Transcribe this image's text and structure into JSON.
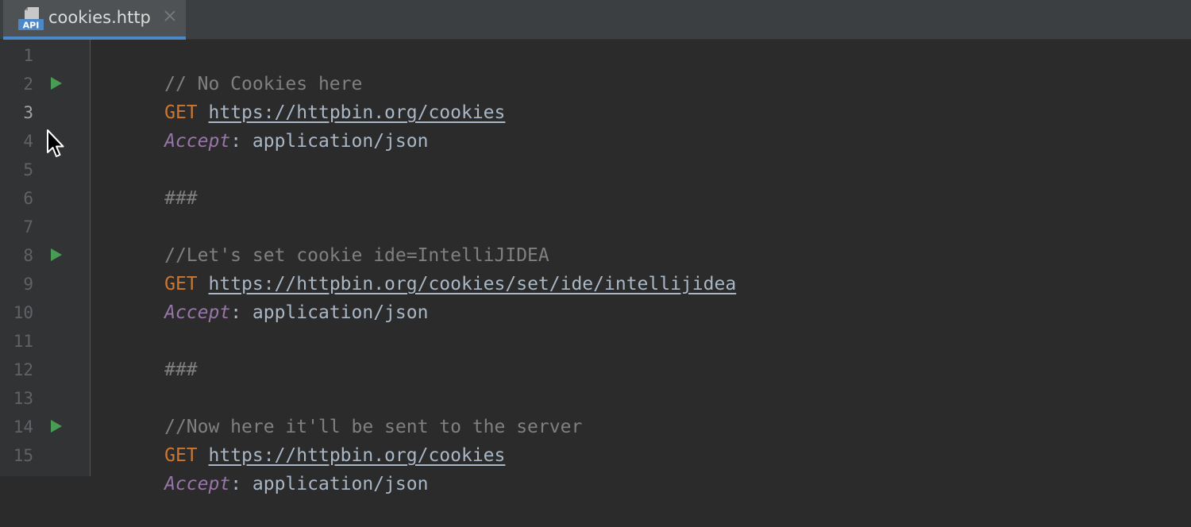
{
  "tab": {
    "label": "cookies.http",
    "icon": "api-file-icon",
    "icon_text": "API",
    "close_icon": "close-icon",
    "active": true
  },
  "gutter": {
    "line_numbers": [
      "1",
      "2",
      "3",
      "4",
      "5",
      "6",
      "7",
      "8",
      "9",
      "10",
      "11",
      "12",
      "13",
      "14",
      "15"
    ],
    "current_line": "3",
    "run_markers_on_lines": [
      "2",
      "8",
      "14"
    ]
  },
  "code": {
    "line1": "// No Cookies here",
    "line2_method": "GET",
    "line2_url": "https://httpbin.org/cookies",
    "line3_header": "Accept",
    "line3_colon": ":",
    "line3_value": " application/json",
    "line5": "###",
    "line7": "//Let's set cookie ide=IntelliJIDEA",
    "line8_method": "GET",
    "line8_url": "https://httpbin.org/cookies/set/ide/intellijidea",
    "line9_header": "Accept",
    "line9_colon": ":",
    "line9_value": " application/json",
    "line11": "###",
    "line13": "//Now here it'll be sent to the server",
    "line14_method": "GET",
    "line14_url": "https://httpbin.org/cookies",
    "line15_header": "Accept",
    "line15_colon": ":",
    "line15_value": " application/json"
  },
  "colors": {
    "editor_background": "#2b2b2b",
    "gutter_background": "#313335",
    "comment": "#808080",
    "method_keyword": "#cc7832",
    "header_name": "#9876aa",
    "plain_text": "#a9b7c6",
    "run_marker": "#499c54",
    "tab_underline": "#4a88c7"
  }
}
